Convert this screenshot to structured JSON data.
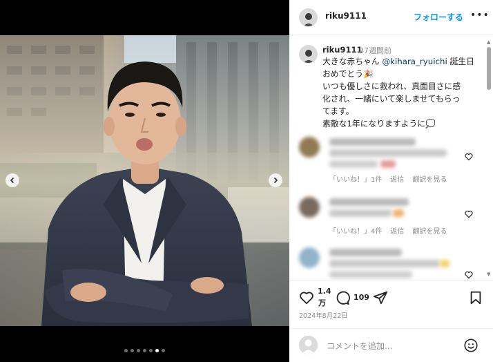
{
  "post": {
    "username": "riku9111",
    "follow_label": "フォローする",
    "more_label": "•••"
  },
  "caption": {
    "username": "riku9111",
    "time": "87週間前",
    "line1_pre": "大きな赤ちゃん ",
    "mention": "@kihara_ryuichi",
    "line1_post": " 誕生日",
    "line2": "おめでとう🎉",
    "line3": "いつも優しさに救われ、真面目さに感",
    "line4": "化され、一緒にいて楽しませてもらっ",
    "line5": "てます。",
    "line6": "素敵な1年になりますように💭"
  },
  "comments": [
    {
      "likes": "「いいね！」1件",
      "reply": "返信",
      "translate": "翻訳を見る"
    },
    {
      "likes": "「いいね！」4件",
      "reply": "返信",
      "translate": "翻訳を見る"
    }
  ],
  "actions": {
    "likes_count": "1.4",
    "likes_unit": "万",
    "comments_count": "109",
    "date": "2024年8月22日"
  },
  "comment_input": {
    "placeholder": "コメントを追加..."
  },
  "carousel": {
    "total_slides": 7,
    "active_slide": 6
  },
  "colors": {
    "accent": "#0095f6",
    "mention": "#00376b",
    "muted": "#8e8e8e",
    "text": "#262626"
  }
}
